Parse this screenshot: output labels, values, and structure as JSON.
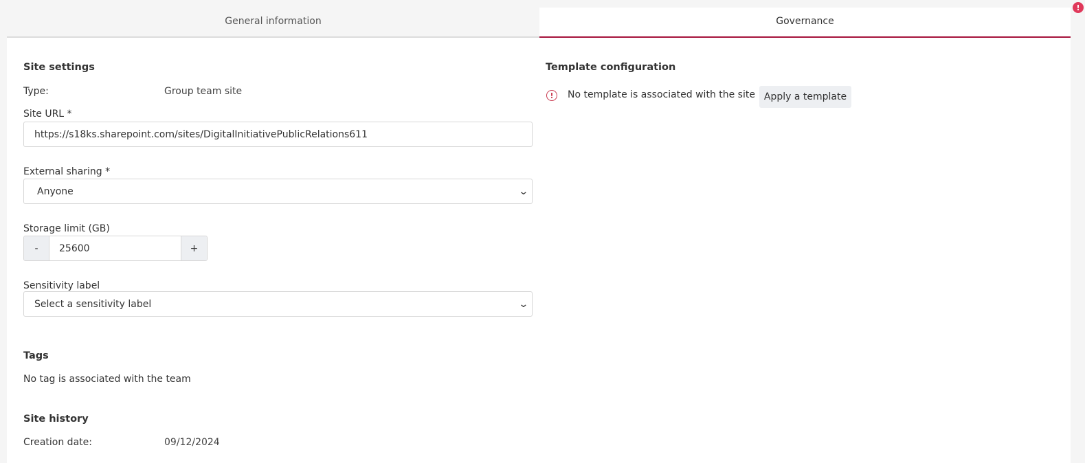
{
  "tabs": [
    {
      "label": "General information"
    },
    {
      "label": "Governance"
    }
  ],
  "site_settings": {
    "heading": "Site settings",
    "type_label": "Type:",
    "type_value": "Group team site",
    "site_url_label": "Site URL *",
    "site_url_value": "https://s18ks.sharepoint.com/sites/DigitalInitiativePublicRelations611",
    "external_sharing_label": "External sharing *",
    "external_sharing_value": "Anyone",
    "storage_label": "Storage limit (GB)",
    "storage_value": "25600",
    "storage_minus": "-",
    "storage_plus": "+",
    "sensitivity_label": "Sensitivity label",
    "sensitivity_value": "Select a sensitivity label"
  },
  "tags": {
    "heading": "Tags",
    "empty_text": "No tag is associated with the team"
  },
  "site_history": {
    "heading": "Site history",
    "creation_label": "Creation date:",
    "creation_value": "09/12/2024"
  },
  "template": {
    "heading": "Template configuration",
    "message": "No template is associated with the site",
    "apply_label": "Apply a template",
    "alert_glyph": "!"
  },
  "colors": {
    "accent": "#a5123a",
    "alert": "#c9394f",
    "badge": "#e0385a"
  },
  "icons": {
    "alert": "alert-circle-icon",
    "chevron": "chevron-down-icon",
    "notification": "error-badge-icon"
  }
}
